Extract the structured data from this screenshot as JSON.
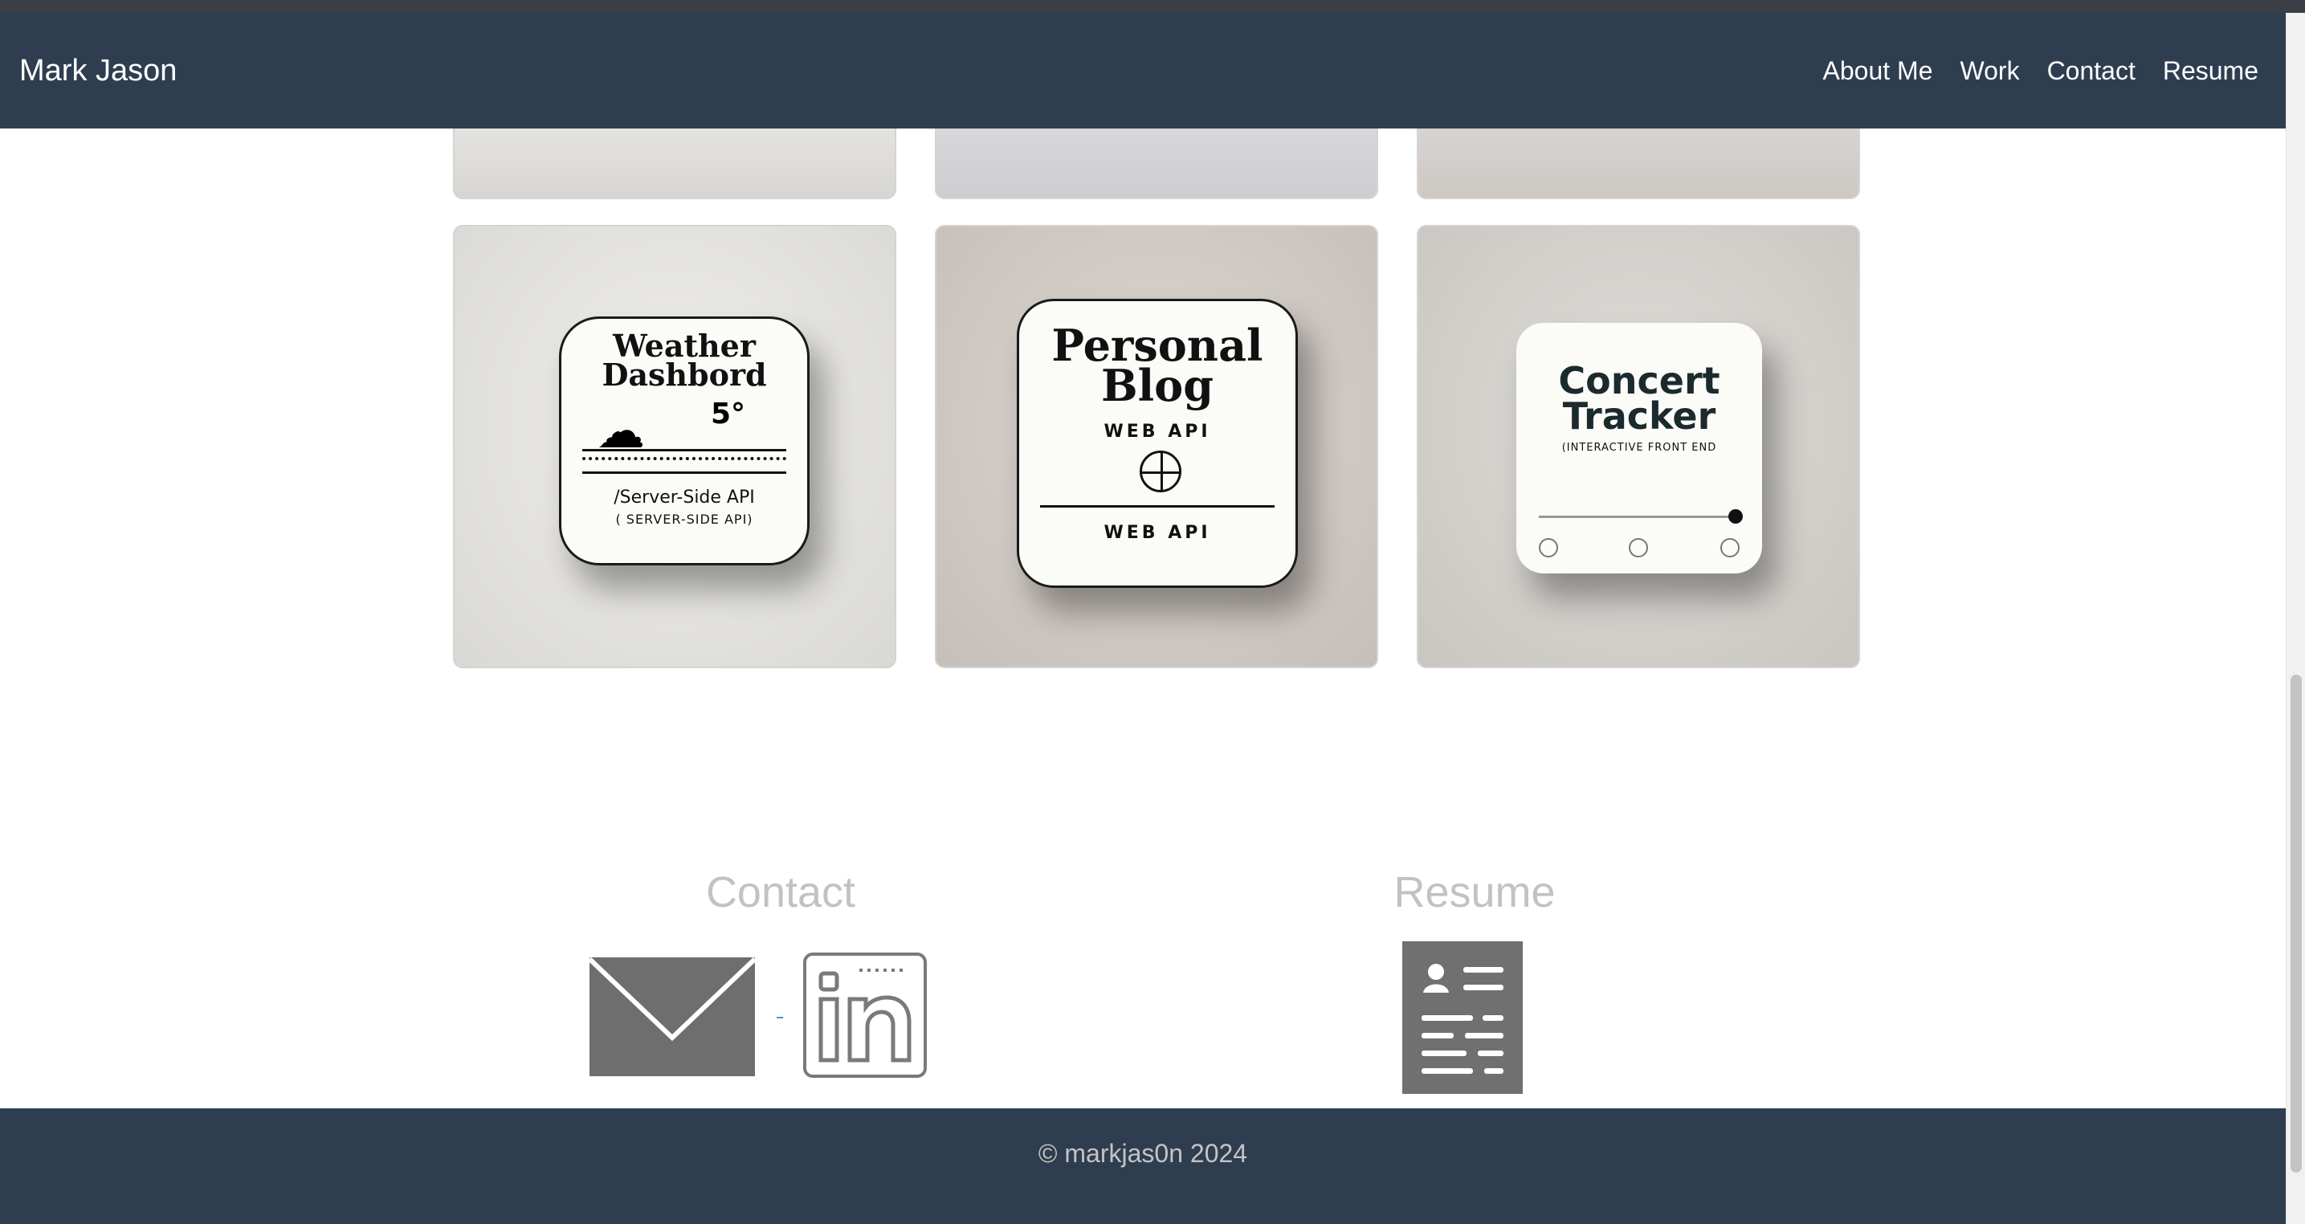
{
  "navbar": {
    "brand": "Mark Jason",
    "links": [
      {
        "label": "About Me"
      },
      {
        "label": "Work"
      },
      {
        "label": "Contact"
      },
      {
        "label": "Resume"
      }
    ]
  },
  "work": {
    "projects": [
      {
        "title_line1": "Weather",
        "title_line2": "Dashbord",
        "weather_mark": "5°",
        "subtitle": "/Server-Side API",
        "subtitle2": "( SERVER-SIDE API)"
      },
      {
        "title_line1": "Personal",
        "title_line2": "Blog",
        "subtitle": "WEB API",
        "subtitle2": "WEB API"
      },
      {
        "title_line1": "Concert",
        "title_line2": "Tracker",
        "subtitle": "(INTERACTIVE FRONT END"
      }
    ]
  },
  "contact": {
    "title": "Contact"
  },
  "resume": {
    "title": "Resume"
  },
  "footer": {
    "text": "© markjas0n 2024"
  },
  "icons": {
    "mail": "envelope-icon",
    "linkedin": "linkedin-icon",
    "resume": "resume-document-icon"
  },
  "colors": {
    "navbar_bg": "#2e3e50",
    "section_title": "#c2c2c2",
    "icon_gray": "#6e6e6e"
  }
}
